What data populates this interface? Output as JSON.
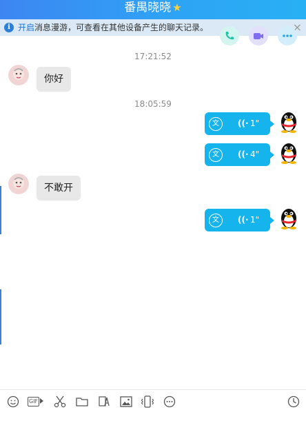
{
  "window": {
    "title": "番禺晓晓",
    "title_icon": "star-icon"
  },
  "notice": {
    "link_text": "开启",
    "text": "消息漫游，可查看在其他设备产生的聊天记录。",
    "close_label": "×"
  },
  "call_buttons": [
    "phone-icon",
    "video-icon",
    "more-icon"
  ],
  "messages": {
    "t1": "17:21:52",
    "m1": "你好",
    "t2": "18:05:59",
    "v1": {
      "duration": "1\"",
      "translate_icon": "文"
    },
    "v2": {
      "duration": "4\"",
      "translate_icon": "文"
    },
    "m2": "不敢开",
    "v3": {
      "duration": "1\"",
      "translate_icon": "文"
    },
    "wave_glyph": "((·"
  },
  "toolbar": {
    "items": [
      "emoji-icon",
      "gif-icon",
      "screenshot-scissors-icon",
      "folder-icon",
      "font-icon",
      "image-icon",
      "vibrate-icon",
      "more-icon",
      "history-clock-icon"
    ],
    "gif_label": "GIF"
  },
  "colors": {
    "accent": "#16b4ec",
    "title_bar": "#2ea3f5",
    "notice_bg": "#dbe9f6"
  }
}
